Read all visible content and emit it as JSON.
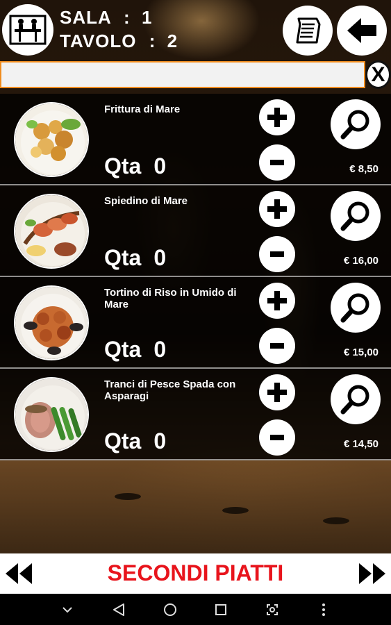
{
  "header": {
    "sala_label": "SALA",
    "sala_value": "1",
    "tavolo_label": "TAVOLO",
    "tavolo_value": "2",
    "separator": ":"
  },
  "search": {
    "value": "",
    "placeholder": "",
    "clear_label": "X"
  },
  "items": [
    {
      "name": "Frittura di Mare",
      "qty_label": "Qta",
      "qty": "0",
      "price": "€ 8,50",
      "image": "fried-seafood"
    },
    {
      "name": "Spiedino di Mare",
      "qty_label": "Qta",
      "qty": "0",
      "price": "€ 16,00",
      "image": "seafood-skewer"
    },
    {
      "name": "Tortino di Riso in Umido di Mare",
      "qty_label": "Qta",
      "qty": "0",
      "price": "€ 15,00",
      "image": "rice-seafood"
    },
    {
      "name": "Tranci di Pesce Spada con Asparagi",
      "qty_label": "Qta",
      "qty": "0",
      "price": "€ 14,50",
      "image": "swordfish-asparagus"
    }
  ],
  "category": {
    "title": "SECONDI PIATTI",
    "color": "#e8141c"
  },
  "colors": {
    "accent_border": "#f08c1e",
    "row_background": "#000000",
    "button_fill": "#ffffff"
  },
  "icons": {
    "room": "table-waiter-icon",
    "menu": "menu-list-icon",
    "back": "back-arrow-icon",
    "plus": "plus-icon",
    "minus": "minus-icon",
    "zoom": "magnifier-icon",
    "prev": "double-chevron-left-icon",
    "next": "double-chevron-right-icon"
  }
}
